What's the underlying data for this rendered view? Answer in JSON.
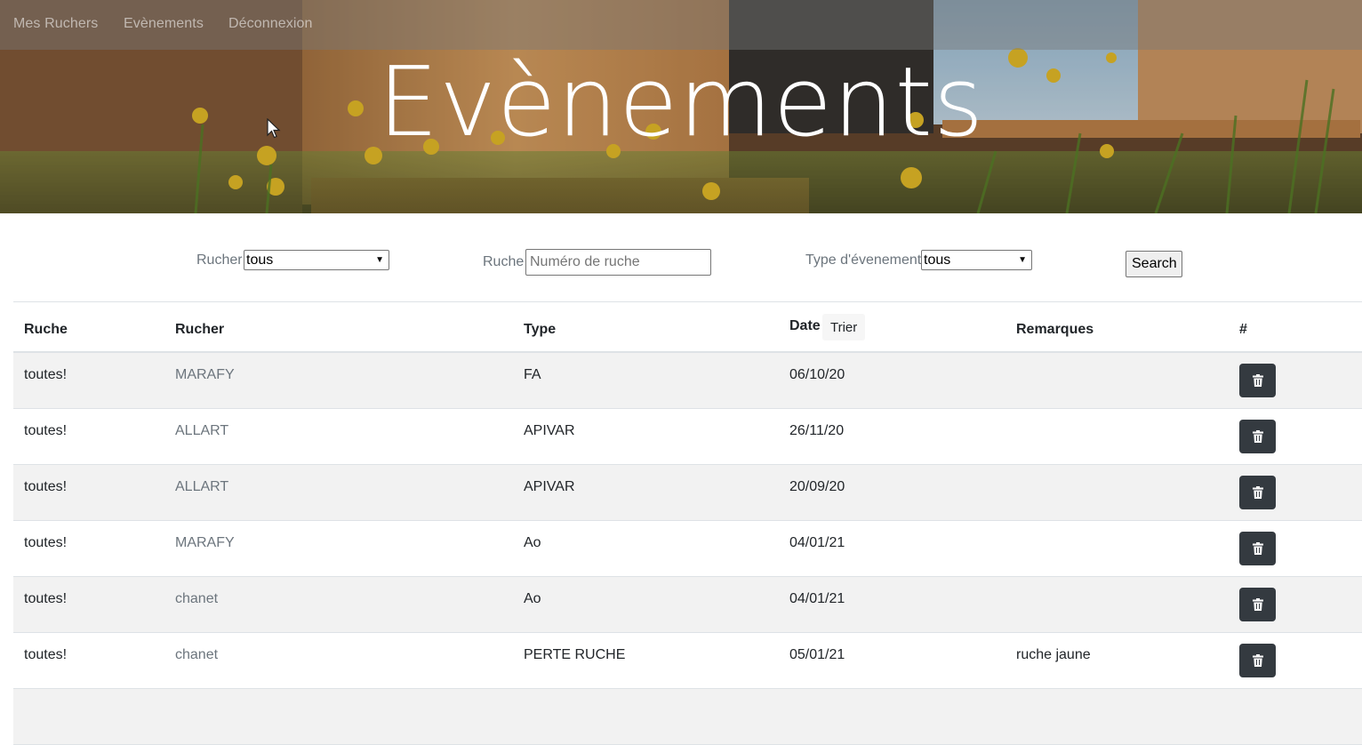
{
  "nav": {
    "items": [
      "Mes Ruchers",
      "Evènements",
      "Déconnexion"
    ]
  },
  "hero": {
    "title": "Evènements"
  },
  "filters": {
    "rucher_label": "Rucher",
    "rucher_value": "tous",
    "ruche_label": "Ruche",
    "ruche_placeholder": "Numéro de ruche",
    "type_label": "Type d'évenement",
    "type_value": "tous",
    "search_label": "Search"
  },
  "table": {
    "headers": {
      "ruche": "Ruche",
      "rucher": "Rucher",
      "type": "Type",
      "date": "Date",
      "trier": "Trier",
      "remarques": "Remarques",
      "actions": "#"
    },
    "rows": [
      {
        "ruche": "toutes!",
        "rucher": "MARAFY",
        "type": "FA",
        "date": "06/10/20",
        "remarques": ""
      },
      {
        "ruche": "toutes!",
        "rucher": "ALLART",
        "type": "APIVAR",
        "date": "26/11/20",
        "remarques": ""
      },
      {
        "ruche": "toutes!",
        "rucher": "ALLART",
        "type": "APIVAR",
        "date": "20/09/20",
        "remarques": ""
      },
      {
        "ruche": "toutes!",
        "rucher": "MARAFY",
        "type": "Ao",
        "date": "04/01/21",
        "remarques": ""
      },
      {
        "ruche": "toutes!",
        "rucher": "chanet",
        "type": "Ao",
        "date": "04/01/21",
        "remarques": ""
      },
      {
        "ruche": "toutes!",
        "rucher": "chanet",
        "type": "PERTE RUCHE",
        "date": "05/01/21",
        "remarques": "ruche jaune"
      }
    ]
  },
  "colors": {
    "delete_button": "#343a40",
    "striped_row": "#f2f2f2",
    "muted_text": "#6c757d"
  },
  "icons": {
    "delete": "trash-icon",
    "cursor": "mouse-pointer-icon"
  }
}
